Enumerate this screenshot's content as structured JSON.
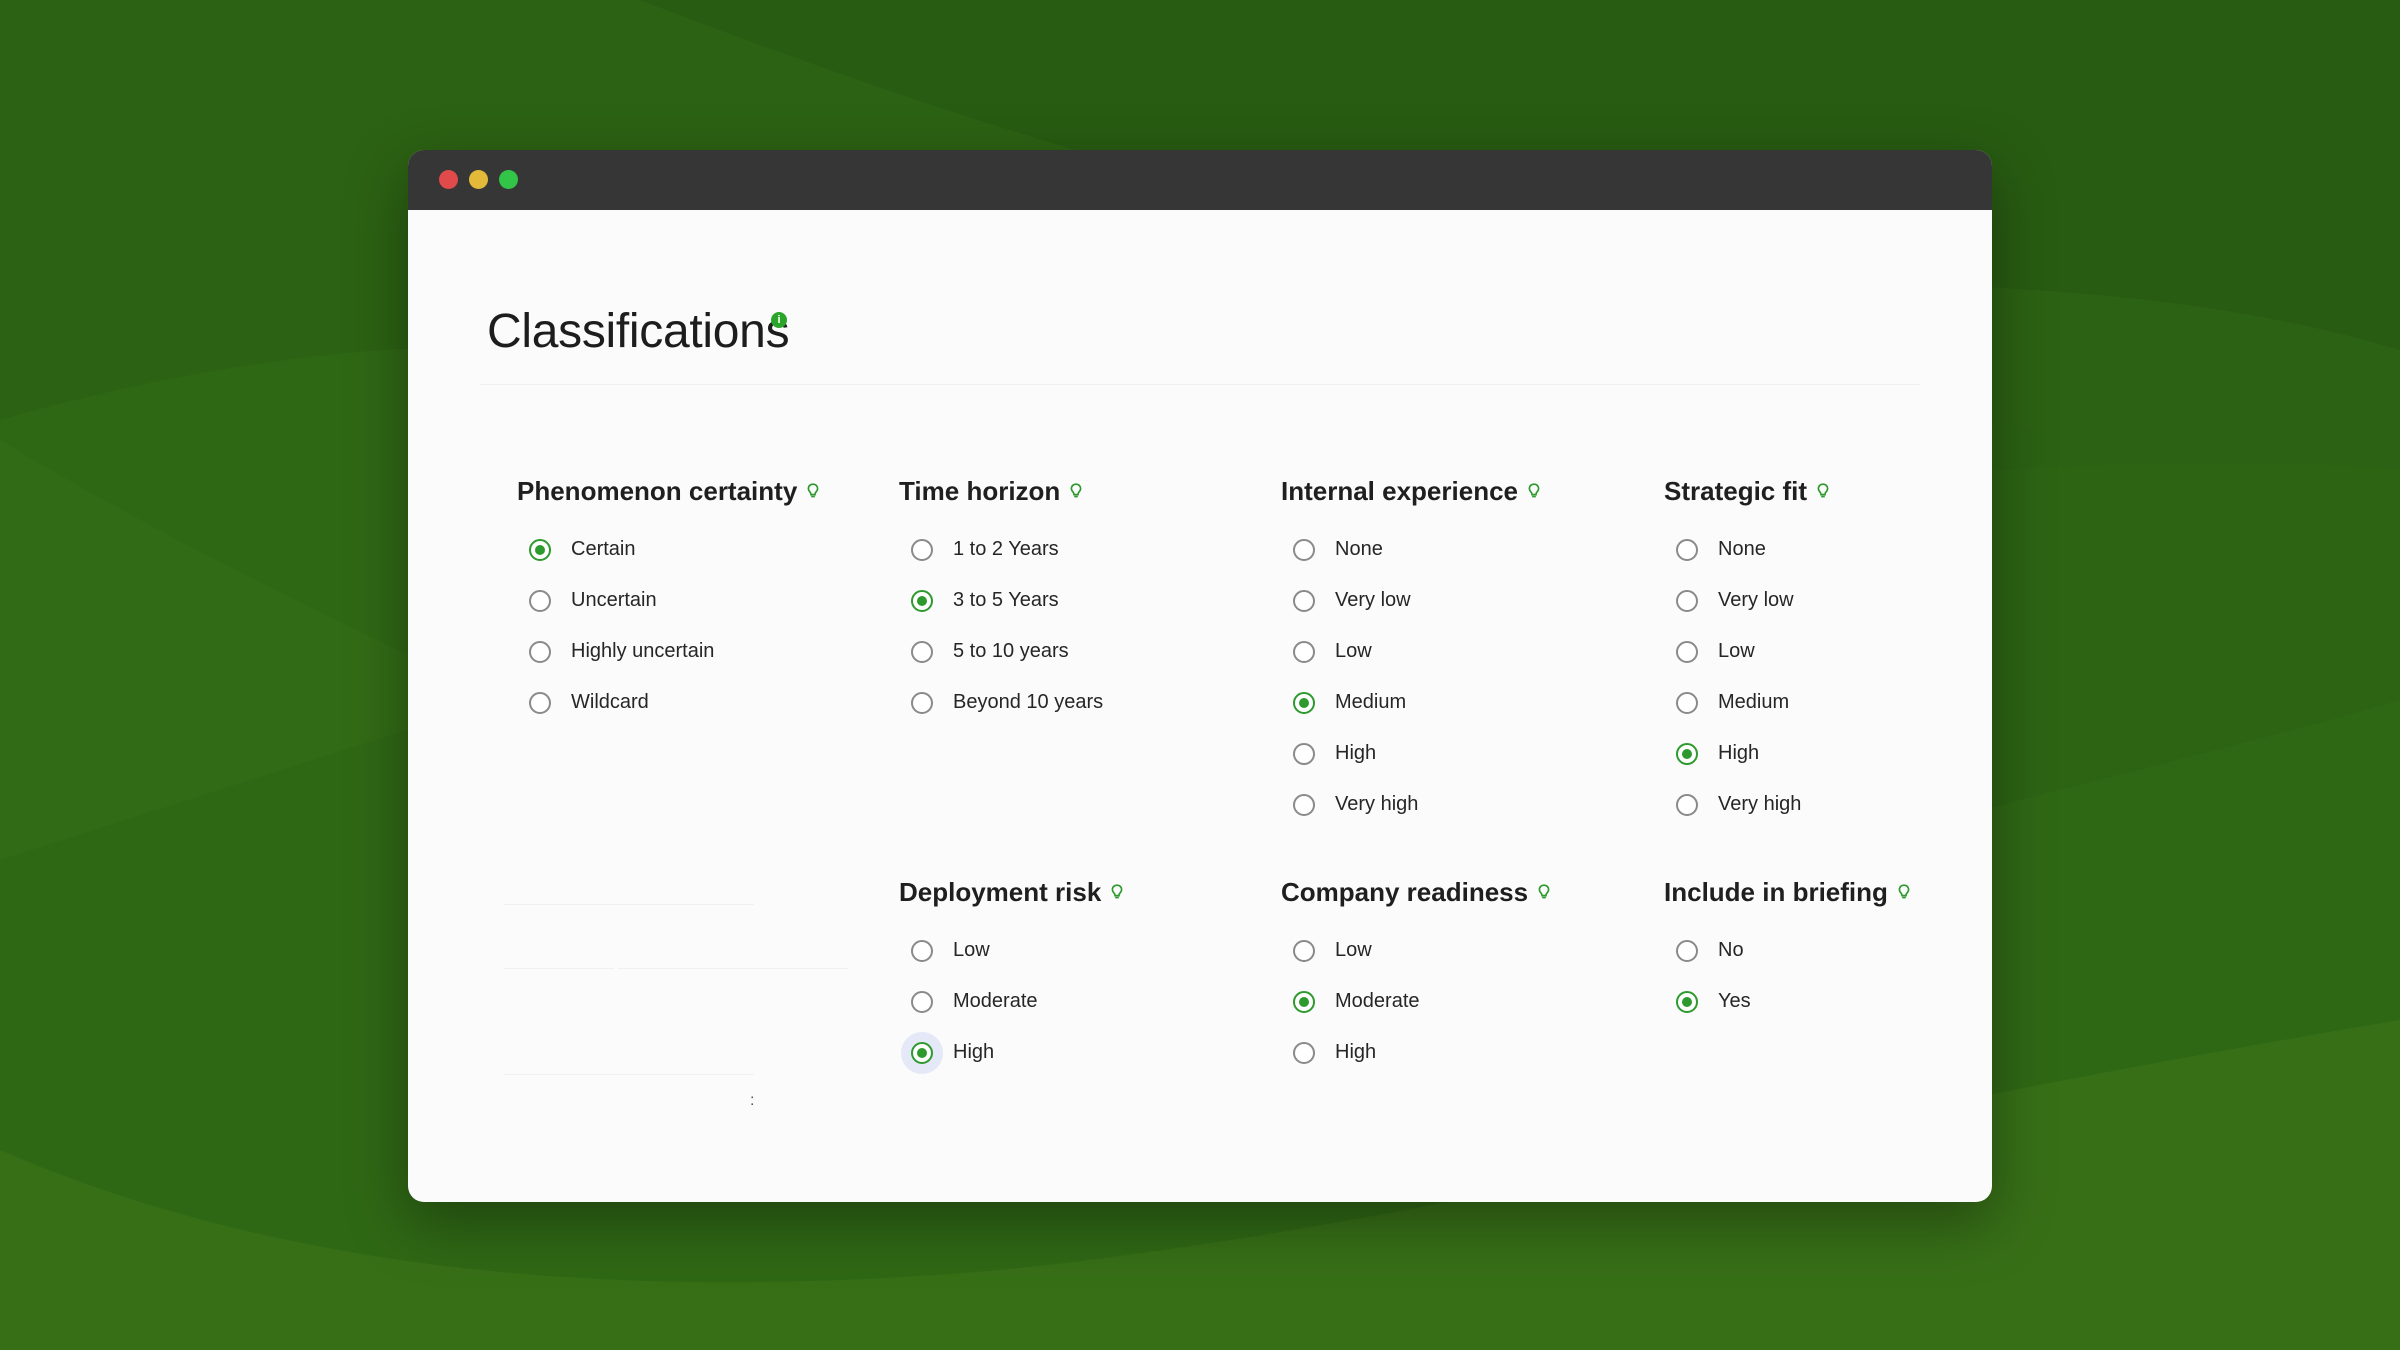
{
  "colors": {
    "background": "#2f6714",
    "titlebar": "#363636",
    "accent": "#2e9a2e",
    "window": "#fbfbfc"
  },
  "window": {
    "controls": [
      "close",
      "minimize",
      "zoom"
    ]
  },
  "page": {
    "title": "Classifications",
    "title_badge": "i"
  },
  "sections": [
    {
      "title": "Phenomenon certainty",
      "icon": "lightbulb-icon",
      "options": [
        "Certain",
        "Uncertain",
        "Highly uncertain",
        "Wildcard"
      ],
      "selected": "Certain"
    },
    {
      "title": "Time horizon",
      "icon": "lightbulb-icon",
      "options": [
        "1 to 2 Years",
        "3 to 5 Years",
        "5 to 10 years",
        "Beyond 10 years"
      ],
      "selected": "3 to 5 Years"
    },
    {
      "title": "Internal experience",
      "icon": "lightbulb-icon",
      "options": [
        "None",
        "Very low",
        "Low",
        "Medium",
        "High",
        "Very high"
      ],
      "selected": "Medium"
    },
    {
      "title": "Strategic fit",
      "icon": "lightbulb-icon",
      "options": [
        "None",
        "Very low",
        "Low",
        "Medium",
        "High",
        "Very high"
      ],
      "selected": "High"
    },
    {
      "title": "Deployment risk",
      "icon": "lightbulb-icon",
      "options": [
        "Low",
        "Moderate",
        "High"
      ],
      "selected": "High",
      "focused": "High"
    },
    {
      "title": "Company readiness",
      "icon": "lightbulb-icon",
      "options": [
        "Low",
        "Moderate",
        "High"
      ],
      "selected": "Moderate"
    },
    {
      "title": "Include in briefing",
      "icon": "lightbulb-icon",
      "options": [
        "No",
        "Yes"
      ],
      "selected": "Yes"
    }
  ],
  "stray_text": ":"
}
